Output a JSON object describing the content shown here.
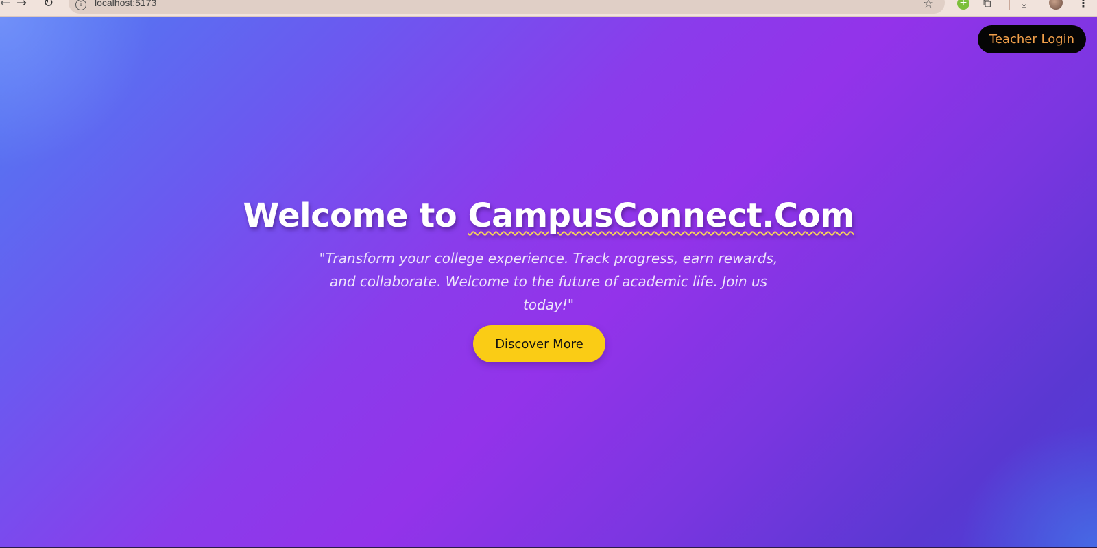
{
  "browser": {
    "url": "localhost:5173",
    "icons": {
      "back": "back-arrow-icon",
      "forward": "forward-arrow-icon",
      "reload": "reload-icon",
      "site_info": "info-icon",
      "bookmark": "star-icon",
      "extension": "green-extension-icon",
      "extensions": "puzzle-icon",
      "downloads": "download-icon",
      "profile": "avatar",
      "menu": "kebab-menu-icon"
    }
  },
  "header": {
    "teacher_login_label": "Teacher Login"
  },
  "hero": {
    "title_prefix": "Welcome to ",
    "title_brand": "CampusConnect.Com",
    "tagline": "\"Transform your college experience. Track progress, earn rewards, and collaborate. Welcome to the future of academic life. Join us today!\"",
    "cta_label": "Discover More"
  },
  "colors": {
    "gradient_start": "#4f7df2",
    "gradient_mid": "#9333ea",
    "gradient_end": "#4c3fd6",
    "cta_background": "#facc15",
    "login_background": "#050505",
    "login_text": "#f2a04a",
    "underline_accent": "#f7d358"
  }
}
